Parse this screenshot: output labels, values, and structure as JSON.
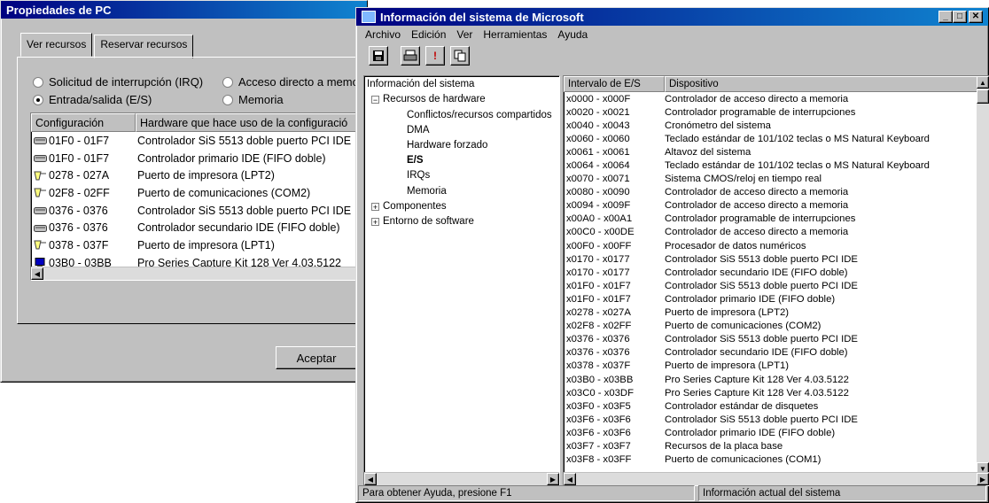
{
  "pc_window": {
    "title": "Propiedades de PC",
    "tabs": [
      "Ver recursos",
      "Reservar recursos"
    ],
    "radios": {
      "irq": "Solicitud de interrupción (IRQ)",
      "dma": "Acceso directo a memo",
      "io": "Entrada/salida (E/S)",
      "mem": "Memoria",
      "selected": "io"
    },
    "columns": [
      "Configuración",
      "Hardware que hace uso de la configuració"
    ],
    "rows": [
      {
        "range": "01F0 - 01F7",
        "device": "Controlador SiS 5513 doble puerto PCI IDE",
        "icon": "disk-controller-icon"
      },
      {
        "range": "01F0 - 01F7",
        "device": "Controlador primario IDE (FIFO doble)",
        "icon": "disk-controller-icon"
      },
      {
        "range": "0278 - 027A",
        "device": "Puerto de impresora (LPT2)",
        "icon": "port-icon"
      },
      {
        "range": "02F8 - 02FF",
        "device": "Puerto de comunicaciones (COM2)",
        "icon": "port-icon"
      },
      {
        "range": "0376 - 0376",
        "device": "Controlador SiS 5513 doble puerto PCI IDE",
        "icon": "disk-controller-icon"
      },
      {
        "range": "0376 - 0376",
        "device": "Controlador secundario IDE (FIFO doble)",
        "icon": "disk-controller-icon"
      },
      {
        "range": "0378 - 037F",
        "device": "Puerto de impresora (LPT1)",
        "icon": "port-icon"
      },
      {
        "range": "03B0 - 03BB",
        "device": "Pro Series Capture Kit 128 Ver 4.03.5122",
        "icon": "display-icon"
      }
    ],
    "ok_label": "Aceptar"
  },
  "info_window": {
    "title": "Información del sistema de Microsoft",
    "menu": [
      "Archivo",
      "Edición",
      "Ver",
      "Herramientas",
      "Ayuda"
    ],
    "tree": {
      "root": "Información del sistema",
      "hardware": "Recursos de hardware",
      "children": [
        "Conflictos/recursos compartidos",
        "DMA",
        "Hardware forzado",
        "E/S",
        "IRQs",
        "Memoria"
      ],
      "selected": "E/S",
      "components": "Componentes",
      "software": "Entorno de software"
    },
    "columns": [
      "Intervalo de E/S",
      "Dispositivo"
    ],
    "rows": [
      [
        "x0000 - x000F",
        "Controlador de acceso directo a memoria"
      ],
      [
        "x0020 - x0021",
        "Controlador programable de interrupciones"
      ],
      [
        "x0040 - x0043",
        "Cronómetro del sistema"
      ],
      [
        "x0060 - x0060",
        "Teclado estándar de 101/102 teclas o MS Natural Keyboard"
      ],
      [
        "x0061 - x0061",
        "Altavoz del sistema"
      ],
      [
        "x0064 - x0064",
        "Teclado estándar de 101/102 teclas o MS Natural Keyboard"
      ],
      [
        "x0070 - x0071",
        "Sistema CMOS/reloj en tiempo real"
      ],
      [
        "x0080 - x0090",
        "Controlador de acceso directo a memoria"
      ],
      [
        "x0094 - x009F",
        "Controlador de acceso directo a memoria"
      ],
      [
        "x00A0 - x00A1",
        "Controlador programable de interrupciones"
      ],
      [
        "x00C0 - x00DE",
        "Controlador de acceso directo a memoria"
      ],
      [
        "x00F0 - x00FF",
        "Procesador de datos numéricos"
      ],
      [
        "x0170 - x0177",
        "Controlador SiS 5513 doble puerto PCI IDE"
      ],
      [
        "x0170 - x0177",
        "Controlador secundario IDE (FIFO doble)"
      ],
      [
        "x01F0 - x01F7",
        "Controlador SiS 5513 doble puerto PCI IDE"
      ],
      [
        "x01F0 - x01F7",
        "Controlador primario IDE (FIFO doble)"
      ],
      [
        "x0278 - x027A",
        "Puerto de impresora (LPT2)"
      ],
      [
        "x02F8 - x02FF",
        "Puerto de comunicaciones (COM2)"
      ],
      [
        "x0376 - x0376",
        "Controlador SiS 5513 doble puerto PCI IDE"
      ],
      [
        "x0376 - x0376",
        "Controlador secundario IDE (FIFO doble)"
      ],
      [
        "x0378 - x037F",
        "Puerto de impresora (LPT1)"
      ],
      [
        "x03B0 - x03BB",
        "Pro Series Capture Kit 128 Ver 4.03.5122"
      ],
      [
        "x03C0 - x03DF",
        "Pro Series Capture Kit 128 Ver 4.03.5122"
      ],
      [
        "x03F0 - x03F5",
        "Controlador estándar de disquetes"
      ],
      [
        "x03F6 - x03F6",
        "Controlador SiS 5513 doble puerto PCI IDE"
      ],
      [
        "x03F6 - x03F6",
        "Controlador primario IDE (FIFO doble)"
      ],
      [
        "x03F7 - x03F7",
        "Recursos de la placa base"
      ],
      [
        "x03F8 - x03FF",
        "Puerto de comunicaciones (COM1)"
      ]
    ],
    "status_left": "Para obtener Ayuda, presione F1",
    "status_right": "Información actual del sistema"
  },
  "colors": {
    "titlebar_start": "#000080",
    "titlebar_end": "#1084d0",
    "face": "#c0c0c0"
  }
}
